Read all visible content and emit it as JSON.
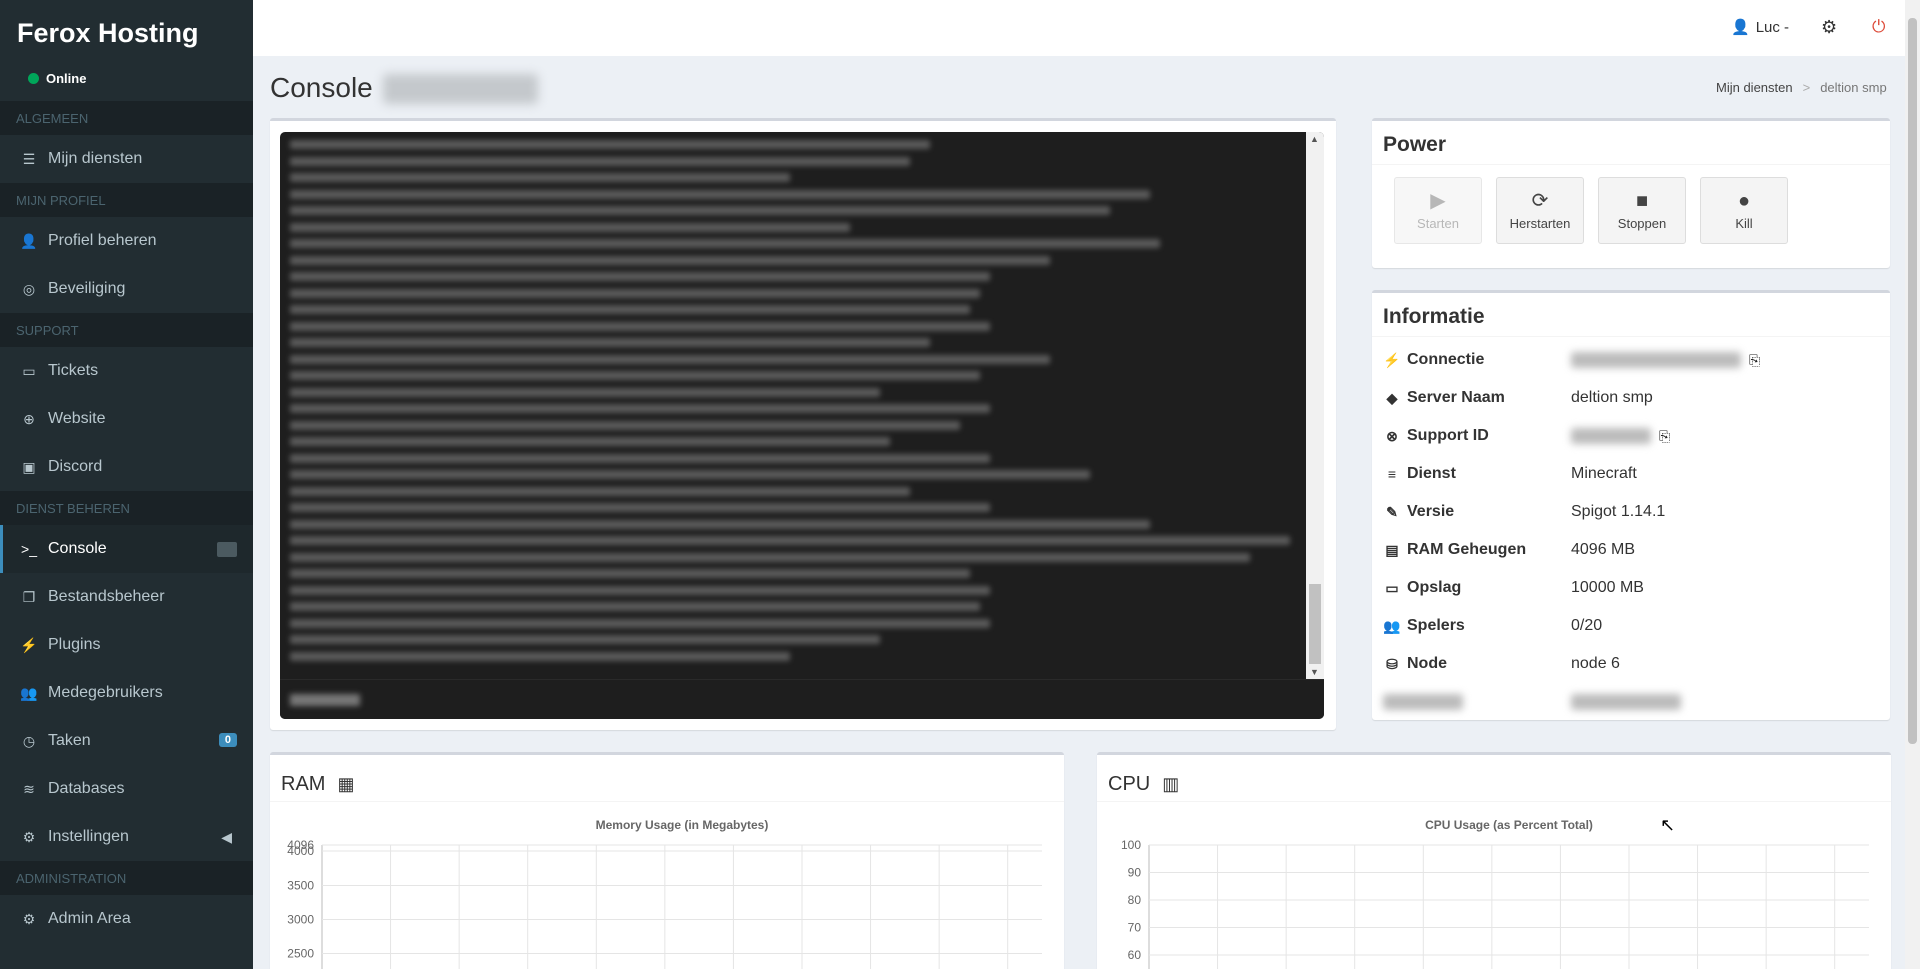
{
  "brand": "Ferox Hosting",
  "status": "Online",
  "sidebar": {
    "sections": [
      {
        "header": "ALGEMEEN",
        "items": [
          {
            "label": "Mijn diensten",
            "icon": "list-icon"
          }
        ]
      },
      {
        "header": "MIJN PROFIEL",
        "items": [
          {
            "label": "Profiel beheren",
            "icon": "user-gear-icon"
          },
          {
            "label": "Beveiliging",
            "icon": "fingerprint-icon"
          }
        ]
      },
      {
        "header": "SUPPORT",
        "items": [
          {
            "label": "Tickets",
            "icon": "ticket-icon"
          },
          {
            "label": "Website",
            "icon": "globe-icon"
          },
          {
            "label": "Discord",
            "icon": "discord-icon"
          }
        ]
      },
      {
        "header": "DIENST BEHEREN",
        "items": [
          {
            "label": "Console",
            "icon": "terminal-icon"
          },
          {
            "label": "Bestandsbeheer",
            "icon": "files-icon"
          },
          {
            "label": "Plugins",
            "icon": "plug-icon"
          },
          {
            "label": "Medegebruikers",
            "icon": "users-icon"
          },
          {
            "label": "Taken",
            "icon": "clock-icon"
          },
          {
            "label": "Databases",
            "icon": "database-icon"
          },
          {
            "label": "Instellingen",
            "icon": "gears-icon"
          }
        ]
      },
      {
        "header": "ADMINISTRATION",
        "items": [
          {
            "label": "Admin Area",
            "icon": "gear-icon"
          }
        ]
      }
    ],
    "taken_badge": "0"
  },
  "topnav": {
    "user": "Luc -"
  },
  "page": {
    "title": "Console",
    "breadcrumb": [
      "Mijn diensten",
      "deltion smp"
    ]
  },
  "power": {
    "title": "Power",
    "buttons": [
      "Starten",
      "Herstarten",
      "Stoppen",
      "Kill"
    ]
  },
  "info": {
    "title": "Informatie",
    "rows": [
      {
        "label": "Connectie",
        "icon": "plug-icon"
      },
      {
        "label": "Server Naam",
        "value": "deltion smp",
        "icon": "tags-icon"
      },
      {
        "label": "Support ID",
        "icon": "lifering-icon"
      },
      {
        "label": "Dienst",
        "value": "Minecraft",
        "icon": "server-icon"
      },
      {
        "label": "Versie",
        "value": "Spigot 1.14.1",
        "icon": "wrench-icon"
      },
      {
        "label": "RAM Geheugen",
        "value": "4096 MB",
        "icon": "memory-icon"
      },
      {
        "label": "Opslag",
        "value": "10000 MB",
        "icon": "hdd-icon"
      },
      {
        "label": "Spelers",
        "value": "0/20",
        "icon": "users-icon"
      },
      {
        "label": "Node",
        "value": "node 6",
        "icon": "node-icon"
      }
    ]
  },
  "ram": {
    "title": "RAM"
  },
  "cpu": {
    "title": "CPU"
  },
  "chart_data": [
    {
      "type": "line",
      "title": "Memory Usage (in Megabytes)",
      "y_ticks": [
        4096,
        4000,
        3500,
        3000,
        2500
      ],
      "series": [],
      "grid": true
    },
    {
      "type": "line",
      "title": "CPU Usage (as Percent Total)",
      "y_ticks": [
        100,
        90,
        80,
        70,
        60
      ],
      "series": [],
      "grid": true
    }
  ],
  "colors": {
    "sidebar": "#222d32",
    "accent": "#3c8dbc",
    "online": "#00a65a",
    "logout": "#dd4b39"
  }
}
